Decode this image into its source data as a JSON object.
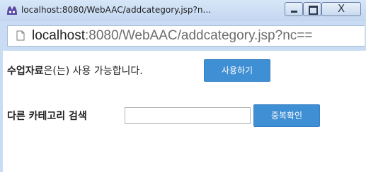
{
  "window": {
    "title": "localhost:8080/WebAAC/addcategory.jsp?n...",
    "close_glyph": "X"
  },
  "address_bar": {
    "host": "localhost",
    "rest": ":8080/WebAAC/addcategory.jsp?nc=="
  },
  "availability": {
    "category_name": "수업자료",
    "message": "은(는) 사용 가능합니다.",
    "use_button_label": "사용하기"
  },
  "search": {
    "label": "다른 카테고리 검색",
    "value": "",
    "check_button_label": "중복확인"
  },
  "colors": {
    "accent_button": "#3f8fd4",
    "titlebar": "#c9dcf4"
  }
}
